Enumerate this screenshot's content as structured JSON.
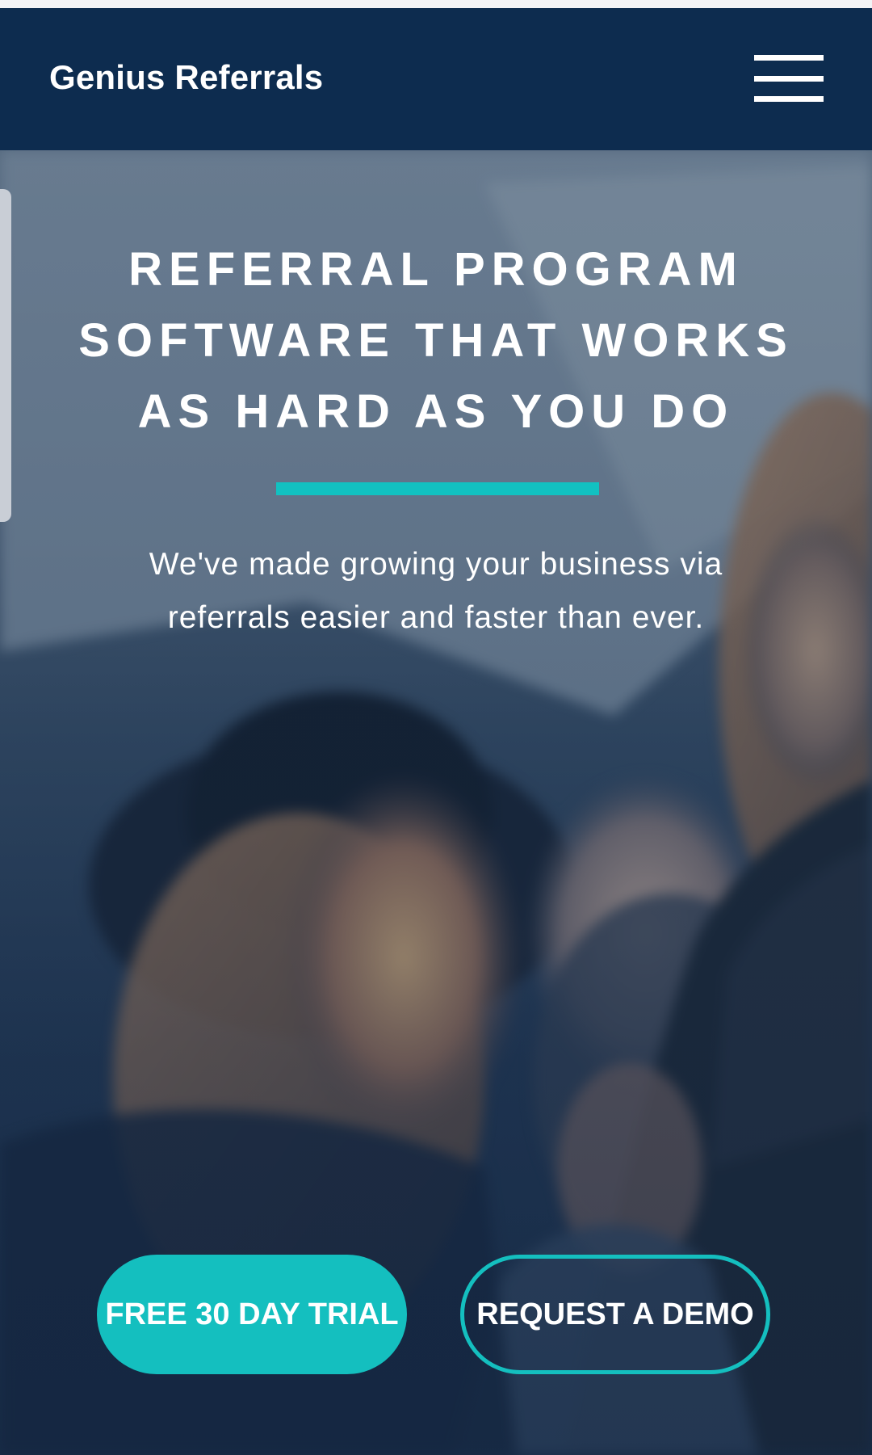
{
  "colors": {
    "nav_background": "#0d2c4f",
    "accent": "#14bfbf",
    "text": "#ffffff"
  },
  "navbar": {
    "brand": "Genius Referrals",
    "menu_icon": "hamburger-menu-icon"
  },
  "hero": {
    "headline": "REFERRAL PROGRAM SOFTWARE THAT WORKS AS HARD AS YOU DO",
    "subtext": "We've made growing your business via referrals easier and faster than ever.",
    "background_image": "blurred photo of smiling people"
  },
  "cta": {
    "trial_label": "FREE 30 DAY TRIAL",
    "demo_label": "REQUEST A DEMO"
  }
}
